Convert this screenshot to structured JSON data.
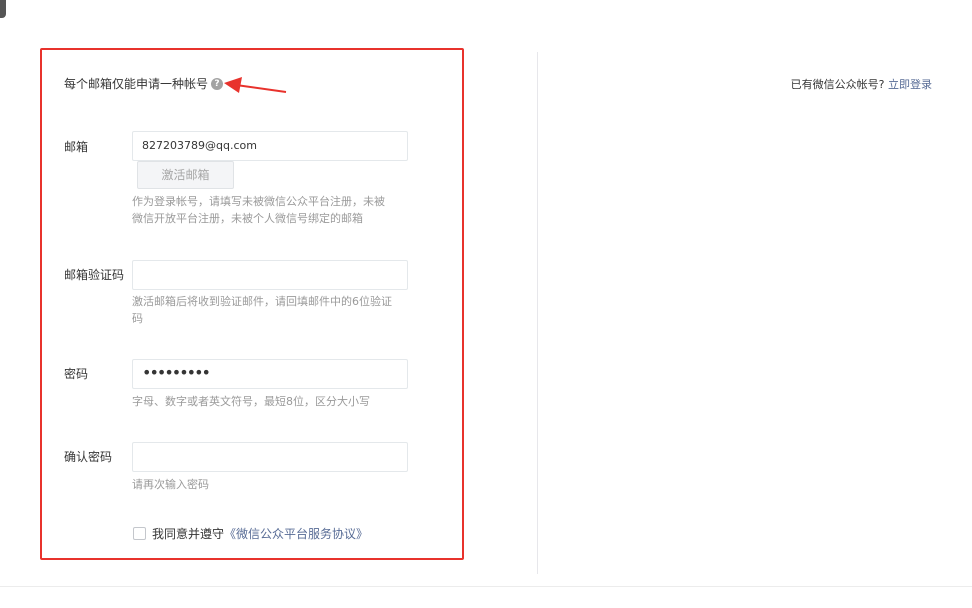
{
  "form": {
    "title": "每个邮箱仅能申请一种帐号",
    "help_icon": "question-icon",
    "email": {
      "label": "邮箱",
      "value": "827203789@qq.com",
      "activate_button": "激活邮箱",
      "hint": "作为登录帐号，请填写未被微信公众平台注册，未被微信开放平台注册，未被个人微信号绑定的邮箱"
    },
    "code": {
      "label": "邮箱验证码",
      "value": "",
      "hint": "激活邮箱后将收到验证邮件，请回填邮件中的6位验证码"
    },
    "password": {
      "label": "密码",
      "value": "•••••••••",
      "hint": "字母、数字或者英文符号，最短8位，区分大小写"
    },
    "confirm": {
      "label": "确认密码",
      "value": "",
      "hint": "请再次输入密码"
    },
    "agreement": {
      "text": "我同意并遵守",
      "link": "《微信公众平台服务协议》"
    }
  },
  "aside": {
    "has_account": "已有微信公众帐号?",
    "login_link": "立即登录"
  },
  "colors": {
    "highlight": "#e8322c",
    "link": "#576b95",
    "hint": "#9a9a9a"
  }
}
